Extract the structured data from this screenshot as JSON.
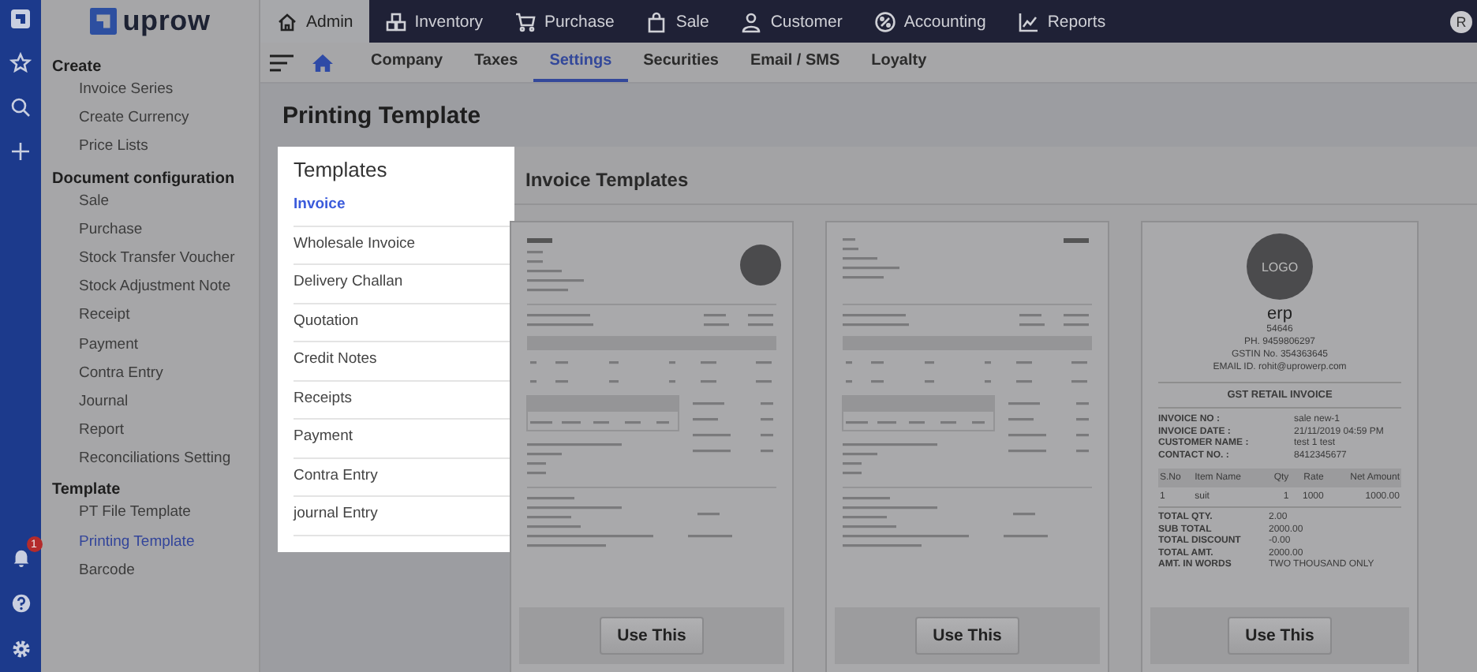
{
  "rail": {
    "notification_badge": "1"
  },
  "sidebar": {
    "logo": "uprow",
    "sections": [
      {
        "title": "Create",
        "items": [
          {
            "label": "Invoice Series",
            "selected": false
          },
          {
            "label": "Create Currency",
            "selected": false
          },
          {
            "label": "Price Lists",
            "selected": false
          }
        ]
      },
      {
        "title": "Document configuration",
        "items": [
          {
            "label": "Sale",
            "selected": false
          },
          {
            "label": "Purchase",
            "selected": false
          },
          {
            "label": "Stock Transfer Voucher",
            "selected": false
          },
          {
            "label": "Stock Adjustment Note",
            "selected": false
          },
          {
            "label": "Receipt",
            "selected": false
          },
          {
            "label": "Payment",
            "selected": false
          },
          {
            "label": "Contra Entry",
            "selected": false
          },
          {
            "label": "Journal",
            "selected": false
          },
          {
            "label": "Report",
            "selected": false
          },
          {
            "label": "Reconciliations Setting",
            "selected": false
          }
        ]
      },
      {
        "title": "Template",
        "items": [
          {
            "label": "PT File Template",
            "selected": false
          },
          {
            "label": "Printing Template",
            "selected": true
          },
          {
            "label": "Barcode",
            "selected": false
          }
        ]
      }
    ]
  },
  "top_nav": [
    {
      "label": "Admin",
      "selected": true
    },
    {
      "label": "Inventory",
      "selected": false
    },
    {
      "label": "Purchase",
      "selected": false
    },
    {
      "label": "Sale",
      "selected": false
    },
    {
      "label": "Customer",
      "selected": false
    },
    {
      "label": "Accounting",
      "selected": false
    },
    {
      "label": "Reports",
      "selected": false
    }
  ],
  "user_avatar": "R",
  "sub_nav": [
    {
      "label": "Company",
      "selected": false
    },
    {
      "label": "Taxes",
      "selected": false
    },
    {
      "label": "Settings",
      "selected": true
    },
    {
      "label": "Securities",
      "selected": false
    },
    {
      "label": "Email / SMS",
      "selected": false
    },
    {
      "label": "Loyalty",
      "selected": false
    }
  ],
  "page_title": "Printing Template",
  "templates_panel": {
    "title": "Templates",
    "items": [
      {
        "label": "Invoice",
        "selected": true
      },
      {
        "label": "Wholesale Invoice",
        "selected": false
      },
      {
        "label": "Delivery Challan",
        "selected": false
      },
      {
        "label": "Quotation",
        "selected": false
      },
      {
        "label": "Credit Notes",
        "selected": false
      },
      {
        "label": "Receipts",
        "selected": false
      },
      {
        "label": "Payment",
        "selected": false
      },
      {
        "label": "Contra Entry",
        "selected": false
      },
      {
        "label": "journal Entry",
        "selected": false
      }
    ]
  },
  "invoice_templates": {
    "title": "Invoice Templates",
    "cards": [
      {
        "kind": "logo_right",
        "button": "Use This"
      },
      {
        "kind": "title_right",
        "button": "Use This"
      },
      {
        "kind": "retail",
        "button": "Use This",
        "logo": "LOGO",
        "company": "erp",
        "address_lines": [
          "54646",
          "PH. 9459806297",
          "GSTIN No. 354363645",
          "EMAIL ID. rohit@uprowerp.com"
        ],
        "heading": "GST RETAIL INVOICE",
        "info": [
          {
            "label": "INVOICE NO :",
            "value": "sale new-1"
          },
          {
            "label": "INVOICE DATE :",
            "value": "21/11/2019 04:59 PM"
          },
          {
            "label": "CUSTOMER NAME :",
            "value": "test 1 test"
          },
          {
            "label": "CONTACT NO. :",
            "value": "8412345677"
          }
        ],
        "columns": [
          "S.No",
          "Item Name",
          "Qty",
          "Rate",
          "Net Amount"
        ],
        "rows": [
          [
            "1",
            "suit",
            "1",
            "1000",
            "1000.00"
          ]
        ],
        "totals": [
          {
            "label": "TOTAL QTY.",
            "value": "2.00"
          },
          {
            "label": "SUB TOTAL",
            "value": "2000.00"
          },
          {
            "label": "TOTAL DISCOUNT",
            "value": "-0.00"
          },
          {
            "label": "TOTAL AMT.",
            "value": "2000.00"
          },
          {
            "label": "AMT. IN WORDS",
            "value": "TWO THOUSAND ONLY"
          }
        ]
      }
    ]
  }
}
